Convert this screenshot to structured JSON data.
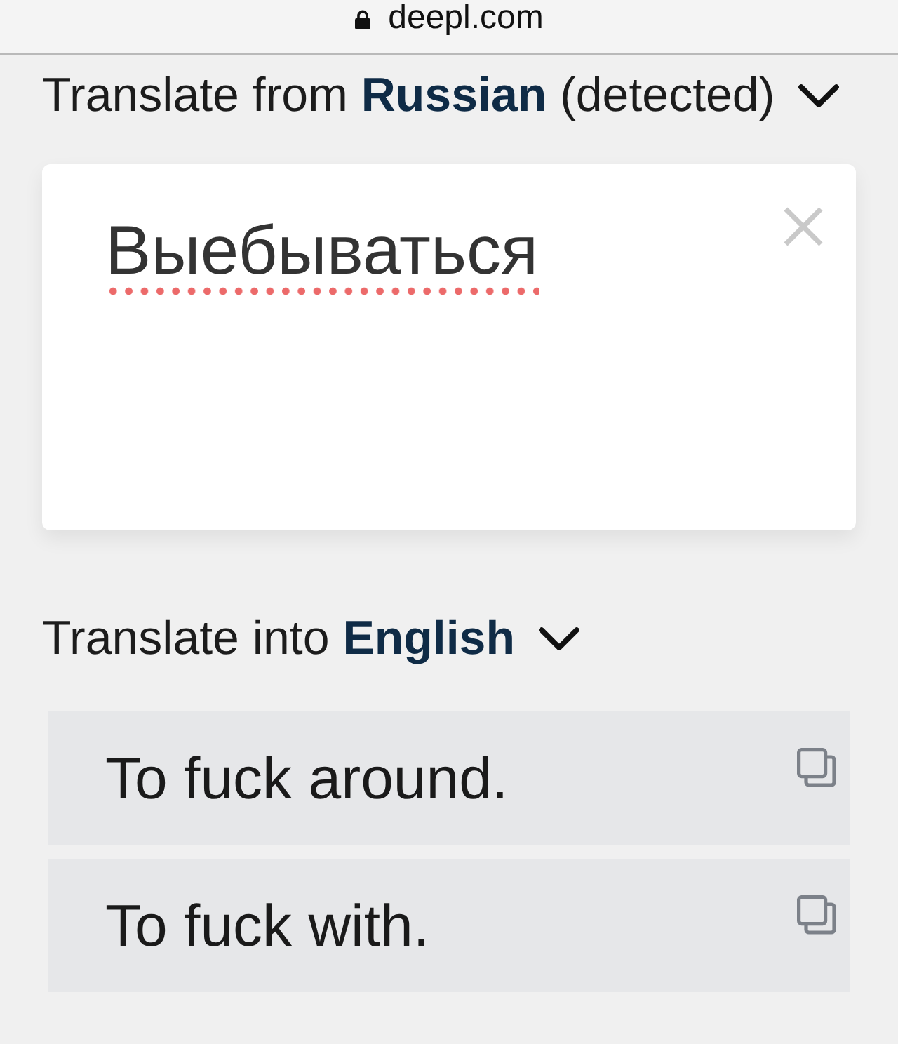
{
  "address_bar": {
    "url": "deepl.com",
    "secure": true
  },
  "source": {
    "label": "Translate from **Russian** (detected)",
    "text": "Выебываться",
    "misspelled": true
  },
  "target": {
    "label": "Translate into **English**"
  },
  "translations": [
    {
      "text": "To fuck around."
    },
    {
      "text": "To fuck with."
    }
  ]
}
